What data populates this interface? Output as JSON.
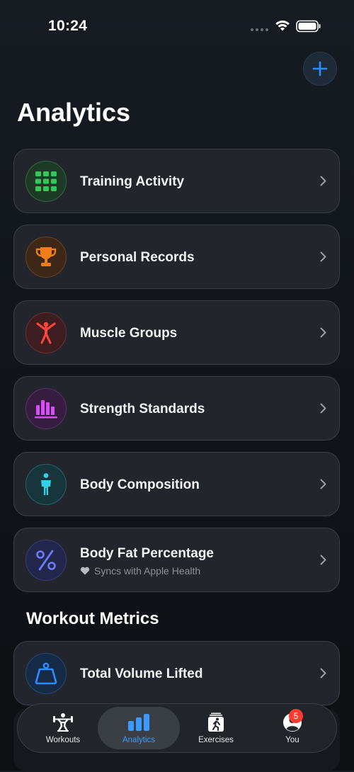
{
  "status_bar": {
    "time": "10:24"
  },
  "header": {
    "title": "Analytics",
    "add_button_icon": "plus-icon"
  },
  "cards": [
    {
      "label": "Training Activity",
      "icon": "grid-icon",
      "color": "#34c759"
    },
    {
      "label": "Personal Records",
      "icon": "trophy-icon",
      "color": "#f07d1a"
    },
    {
      "label": "Muscle Groups",
      "icon": "person-arms-up-icon",
      "color": "#ff453a"
    },
    {
      "label": "Strength Standards",
      "icon": "bar-chart-icon",
      "color": "#d64df5"
    },
    {
      "label": "Body Composition",
      "icon": "person-standing-icon",
      "color": "#32d2e6"
    },
    {
      "label": "Body Fat Percentage",
      "subtitle": "Syncs with Apple Health",
      "icon": "percent-icon",
      "color": "#6b7cff"
    }
  ],
  "section": {
    "title": "Workout Metrics"
  },
  "metric_cards": [
    {
      "label": "Total Volume Lifted",
      "icon": "weight-icon",
      "color": "#2d8cff"
    }
  ],
  "tab_bar": {
    "tabs": [
      {
        "label": "Workouts",
        "icon": "weightlifter-icon"
      },
      {
        "label": "Analytics",
        "icon": "analytics-bars-icon",
        "active": true
      },
      {
        "label": "Exercises",
        "icon": "runner-card-icon"
      },
      {
        "label": "You",
        "icon": "person-circle-icon",
        "badge": "5"
      }
    ]
  }
}
